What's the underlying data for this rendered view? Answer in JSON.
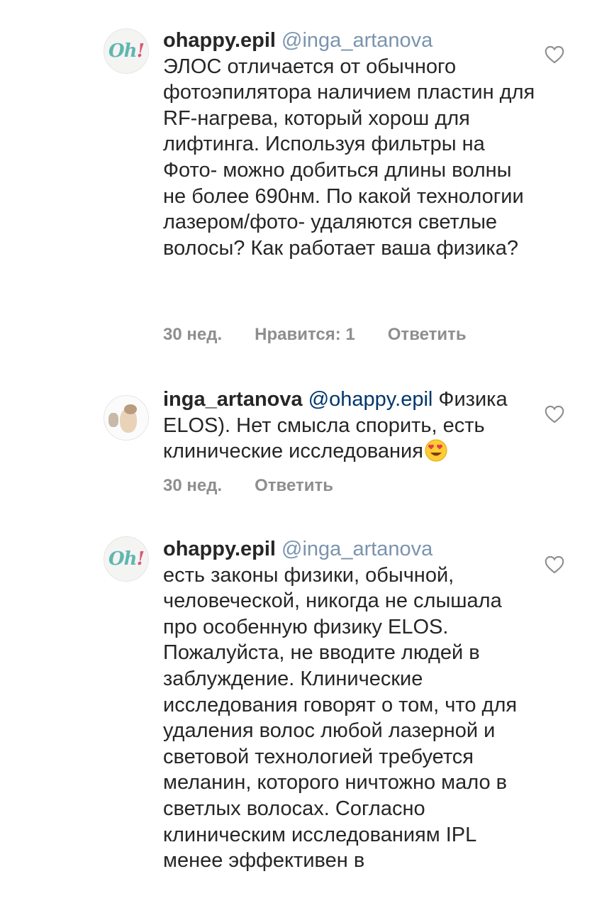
{
  "comments": [
    {
      "username": "ohappy.epil",
      "mention": "@inga_artanova",
      "text": "ЭЛОС отличается от обычного фотоэпилятора наличием пластин для RF-нагрева, который хорош для лифтинга. Используя фильтры на Фото- можно добиться длины волны не более 690нм. По какой технологии лазером/фото- удаляются светлые волосы? Как работает ваша физика?",
      "time": "30 нед.",
      "likes": "Нравится: 1",
      "reply": "Ответить"
    },
    {
      "username": "inga_artanova",
      "mention": "@ohappy.epil",
      "text": "Физика ELOS). Нет смысла спорить, есть клинические исследования",
      "emoji": "heart-eyes-emoji",
      "time": "30 нед.",
      "reply": "Ответить"
    },
    {
      "username": "ohappy.epil",
      "mention": "@inga_artanova",
      "text": "есть законы физики, обычной, человеческой, никогда не слышала про особенную физику ELOS. Пожалуйста, не вводите людей в заблуждение. Клинические исследования говорят о том, что для удаления волос любой лазерной и световой технологией требуется меланин, которого ничтожно мало в светлых волосах. Согласно клиническим исследованиям IPL менее эффективен в"
    }
  ],
  "icons": {
    "like": "heart-outline-icon",
    "avatar_logo": "Oh!"
  },
  "colors": {
    "text": "#262626",
    "meta": "#8e8e8e",
    "mention": "#00376b",
    "logo_teal": "#5fb7b0",
    "logo_pink": "#d9577a"
  }
}
